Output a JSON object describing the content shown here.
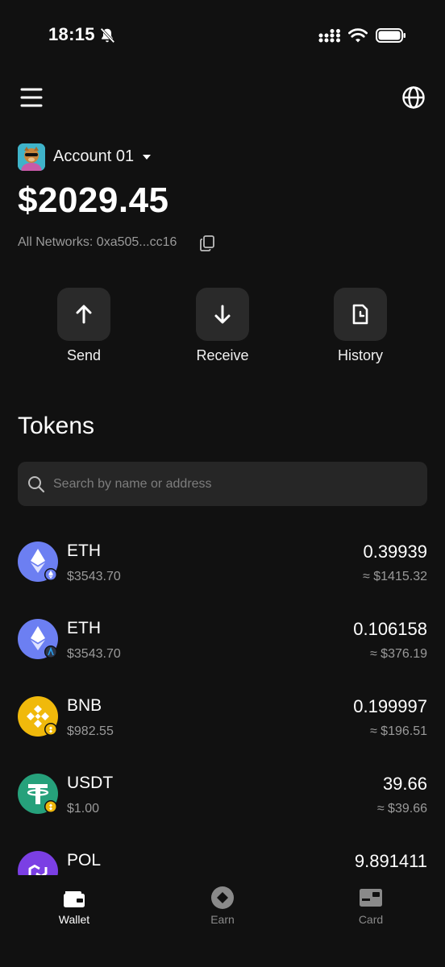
{
  "status_bar": {
    "time": "18:15"
  },
  "account": {
    "name": "Account 01",
    "balance": "$2029.45",
    "networks": "All Networks:  0xa505...cc16"
  },
  "actions": [
    {
      "label": "Send",
      "icon": "arrow-up-icon"
    },
    {
      "label": "Receive",
      "icon": "arrow-down-icon"
    },
    {
      "label": "History",
      "icon": "history-icon"
    }
  ],
  "tokens_section": {
    "title": "Tokens",
    "search_placeholder": "Search by name or address"
  },
  "tokens": [
    {
      "symbol": "ETH",
      "price": "$3543.70",
      "amount": "0.39939",
      "value": "≈ $1415.32",
      "logo": "eth-logo",
      "badge": "ethereum-network-badge"
    },
    {
      "symbol": "ETH",
      "price": "$3543.70",
      "amount": "0.106158",
      "value": "≈ $376.19",
      "logo": "eth-logo",
      "badge": "arbitrum-network-badge"
    },
    {
      "symbol": "BNB",
      "price": "$982.55",
      "amount": "0.199997",
      "value": "≈ $196.51",
      "logo": "bnb-logo",
      "badge": "bsc-network-badge"
    },
    {
      "symbol": "USDT",
      "price": "$1.00",
      "amount": "39.66",
      "value": "≈ $39.66",
      "logo": "usdt-logo",
      "badge": "bsc-network-badge"
    },
    {
      "symbol": "POL",
      "price": "",
      "amount": "9.891411",
      "value": "",
      "logo": "pol-logo",
      "badge": ""
    }
  ],
  "bottom_nav": [
    {
      "label": "Wallet",
      "icon": "wallet-icon",
      "active": true
    },
    {
      "label": "Earn",
      "icon": "earn-icon",
      "active": false
    },
    {
      "label": "Card",
      "icon": "card-icon",
      "active": false
    }
  ],
  "colors": {
    "background": "#111111",
    "button": "#2a2a2a",
    "muted": "#9a9a9a",
    "eth": "#6c7ff2",
    "bnb": "#f0b90b",
    "usdt": "#26a17b",
    "pol": "#7b3fe4"
  }
}
